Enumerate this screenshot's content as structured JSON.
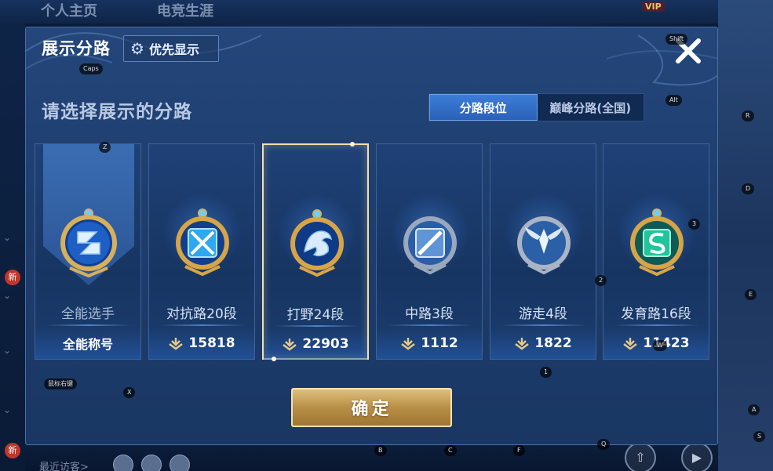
{
  "background": {
    "tabs": [
      "个人主页",
      "电竞生涯"
    ],
    "vip": "VIP",
    "new_badge": "新",
    "recent_visitors": "最近访客>"
  },
  "dialog": {
    "title": "展示分路",
    "priority_button": "优先显示",
    "subtitle": "请选择展示的分路",
    "segments": [
      {
        "label": "分路段位",
        "active": true
      },
      {
        "label": "巅峰分路(全国)",
        "active": false
      }
    ],
    "lanes": [
      {
        "name": "全能选手",
        "bottom_label": "全能称号",
        "icon": "all-round-medal-icon",
        "selected": false
      },
      {
        "name": "对抗路20段",
        "score": "15818",
        "icon": "clash-lane-medal-icon",
        "selected": false
      },
      {
        "name": "打野24段",
        "score": "22903",
        "icon": "jungle-dragon-medal-icon",
        "selected": true
      },
      {
        "name": "中路3段",
        "score": "1112",
        "icon": "mid-lane-medal-icon",
        "selected": false
      },
      {
        "name": "游走4段",
        "score": "1822",
        "icon": "roam-wings-medal-icon",
        "selected": false
      },
      {
        "name": "发育路16段",
        "score": "11423",
        "icon": "farm-lane-medal-icon",
        "selected": false
      }
    ],
    "confirm_button": "确定"
  },
  "key_hints": [
    "Caps",
    "Shift",
    "Alt",
    "Z",
    "X",
    "R",
    "D",
    "E",
    "A",
    "S",
    "W",
    "Q",
    "B",
    "C",
    "F",
    "1",
    "2",
    "3",
    "鼠标右键"
  ],
  "colors": {
    "accent_gold": "#f2dfaa",
    "segment_active": "#3c7dd8",
    "panel": "#1f3f70"
  }
}
